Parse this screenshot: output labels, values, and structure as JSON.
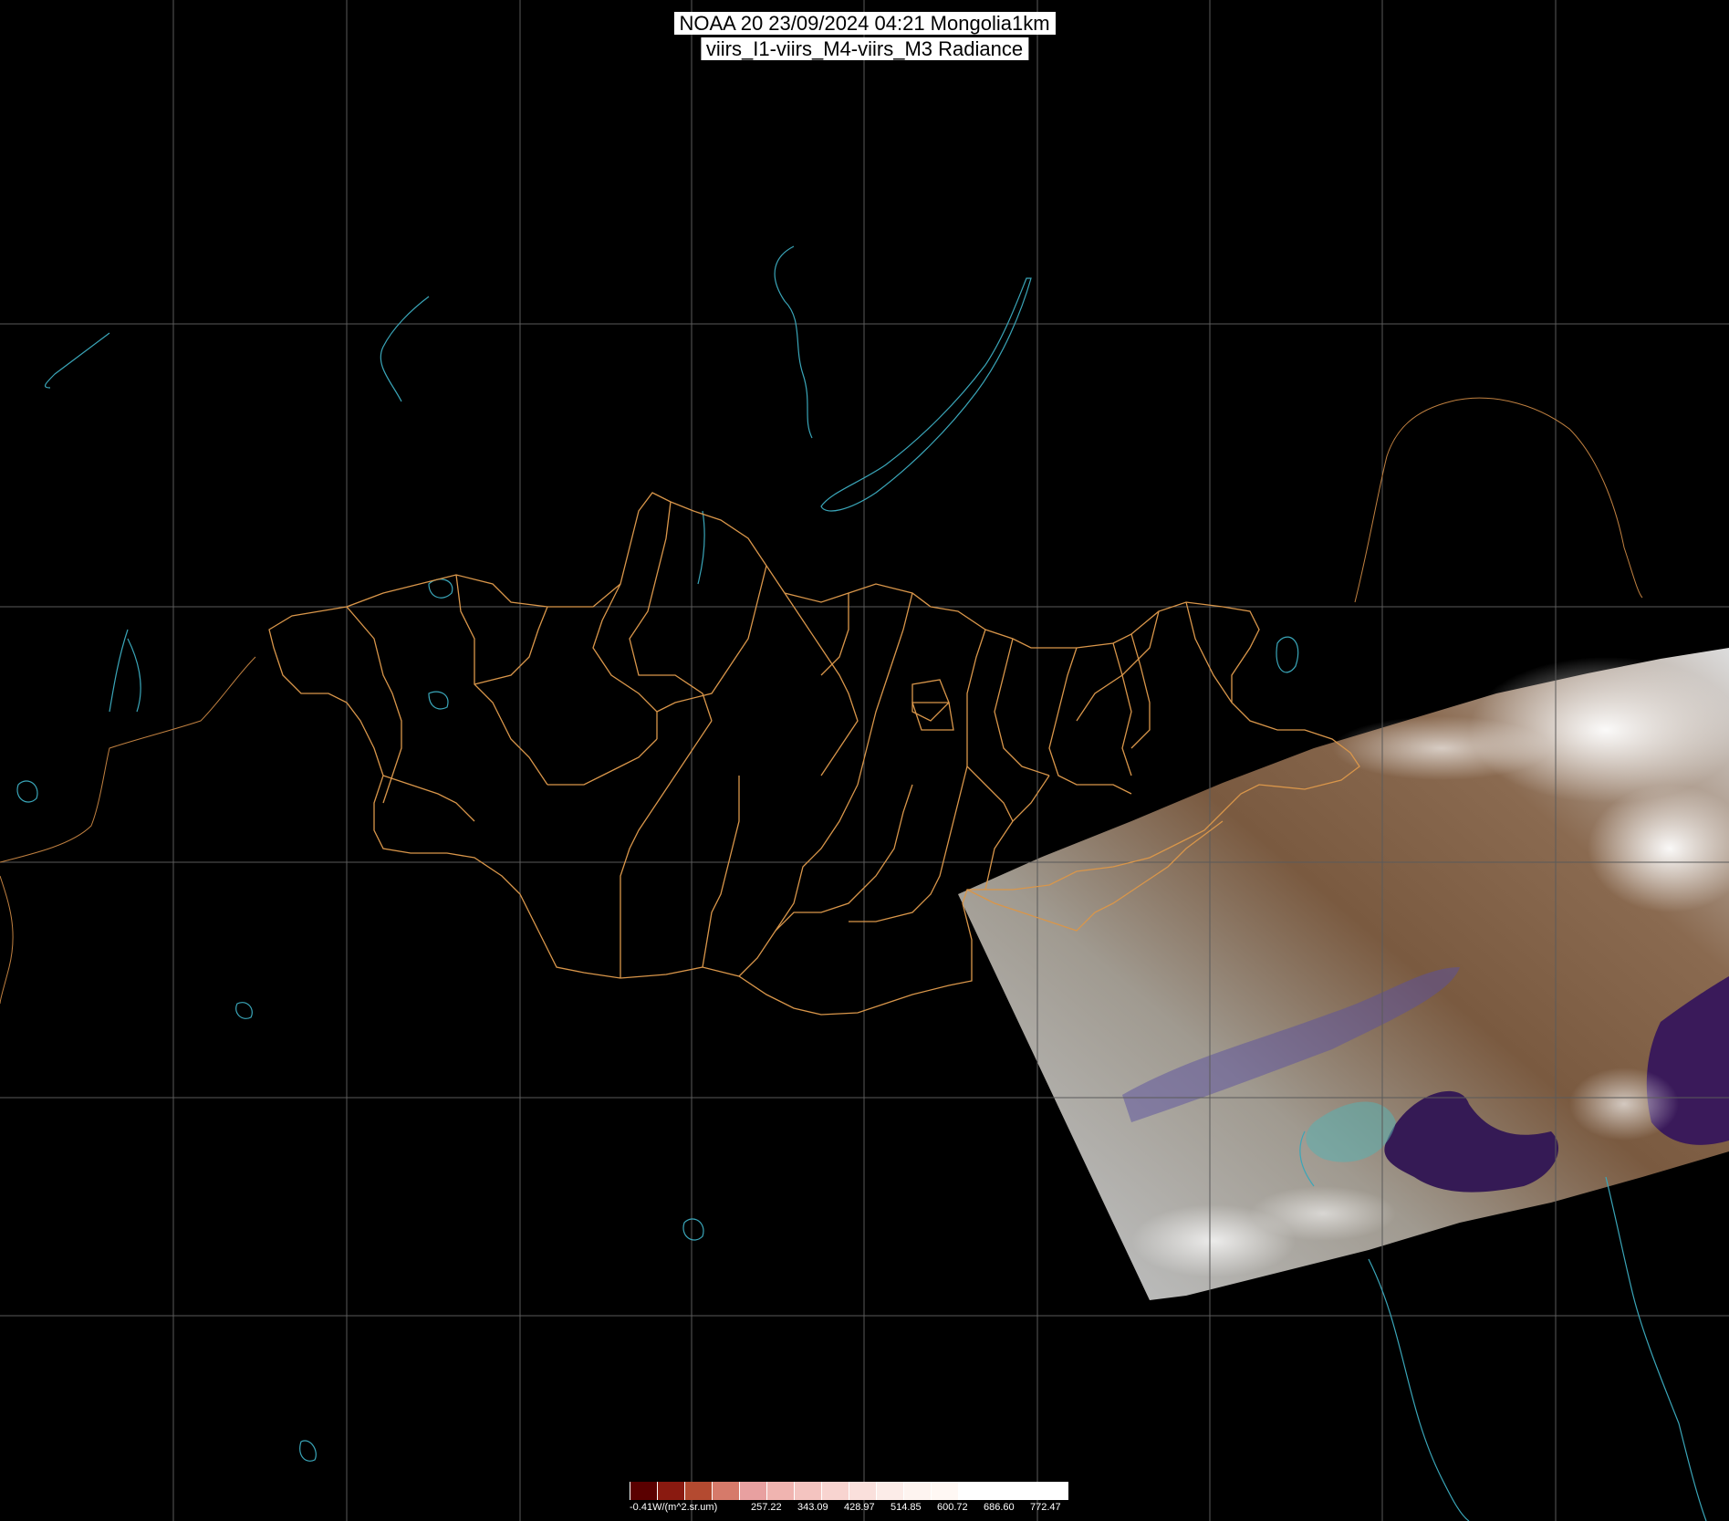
{
  "header": {
    "line1": "NOAA 20 23/09/2024 04:21 Mongolia1km",
    "line2": "viirs_I1-viirs_M4-viirs_M3 Radiance"
  },
  "colors": {
    "background": "#000000",
    "graticule": "#5a5a5a",
    "admin_borders": "#d9964a",
    "coastlines": "#3aa6b9",
    "title_box": "#ffffff"
  },
  "colorbar": {
    "unit_label": "-0.41W/(m^2.sr.um)",
    "tick_labels": [
      "257.22",
      "343.09",
      "428.97",
      "514.85",
      "600.72",
      "686.60",
      "772.47"
    ],
    "swatch_colors": [
      "#5a0000",
      "#8a1a10",
      "#b44a30",
      "#d67a6a",
      "#e8a0a0",
      "#f0b4b0",
      "#f4c4c0",
      "#f8d4d0",
      "#fae0dc",
      "#fcece8",
      "#fef4f0",
      "#fff8f4",
      "#ffffff",
      "#ffffff",
      "#ffffff",
      "#ffffff"
    ]
  }
}
